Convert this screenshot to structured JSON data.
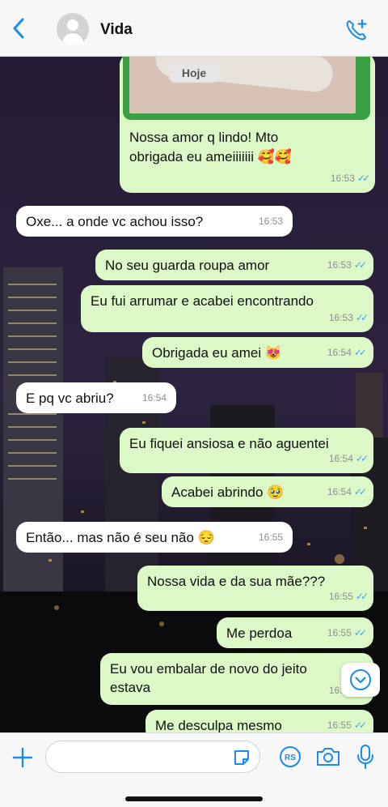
{
  "header": {
    "contact_name": "Vida",
    "back_icon": "chevron-left-icon",
    "call_icon": "phone-add-icon"
  },
  "chat": {
    "date_pill": "Hoje",
    "messages": [
      {
        "dir": "out",
        "text": "Nossa amor q lindo! Mto obrigada eu ameiiiiiii 🥰🥰",
        "time": "16:53",
        "read": true
      },
      {
        "dir": "in",
        "text": "Oxe... a onde vc achou isso?",
        "time": "16:53"
      },
      {
        "dir": "out",
        "text": "No seu guarda roupa amor",
        "time": "16:53",
        "read": true
      },
      {
        "dir": "out",
        "text": "Eu fui arrumar e acabei encontrando",
        "time": "16:53",
        "read": true
      },
      {
        "dir": "out",
        "text": "Obrigada eu amei 😻",
        "time": "16:54",
        "read": true
      },
      {
        "dir": "in",
        "text": "E pq vc abriu?",
        "time": "16:54"
      },
      {
        "dir": "out",
        "text": "Eu fiquei ansiosa e não aguentei",
        "time": "16:54",
        "read": true
      },
      {
        "dir": "out",
        "text": "Acabei abrindo 🥹",
        "time": "16:54",
        "read": true
      },
      {
        "dir": "in",
        "text": "Então... mas não é seu não 😔",
        "time": "16:55"
      },
      {
        "dir": "out",
        "text": "Nossa vida e da sua mãe???",
        "time": "16:55",
        "read": true
      },
      {
        "dir": "out",
        "text": "Me perdoa",
        "time": "16:55",
        "read": true
      },
      {
        "dir": "out",
        "text": "Eu vou embalar de novo do jeito estava",
        "time": "16:55",
        "read": true
      },
      {
        "dir": "out",
        "text": "Me desculpa mesmo",
        "time": "16:55",
        "read": true
      }
    ]
  },
  "composer": {
    "plus_icon": "plus-icon",
    "sticker_icon": "sticker-icon",
    "rs_icon": "rs-payment-icon",
    "camera_icon": "camera-icon",
    "mic_icon": "microphone-icon"
  },
  "colors": {
    "accent": "#1a8bf0",
    "bubble_out": "#dcf8c6",
    "bubble_in": "#ffffff",
    "ticks": "#4ca3e6"
  }
}
